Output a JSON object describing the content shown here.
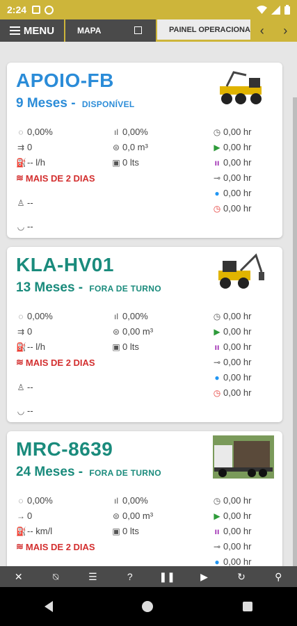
{
  "status_bar": {
    "time": "2:24"
  },
  "nav": {
    "menu_label": "MENU",
    "tabs": [
      {
        "label": "MAPA"
      },
      {
        "label": "PAINEL OPERACIONAL"
      }
    ],
    "prev_arrow": "‹",
    "next_arrow": "›"
  },
  "colors": {
    "accent": "#cdb53a",
    "dark": "#4a4a4a",
    "title_blue": "#2b8cd8",
    "title_teal": "#1a8b7c",
    "alert_red": "#d32f2f"
  },
  "cards": [
    {
      "title": "APOIO-FB",
      "months": "9 Meses",
      "status": "DISPONÍVEL",
      "title_color": "#2b8cd8",
      "status_color": "#2b8cd8",
      "image": "forwarder-machine",
      "c1": [
        "0,00%",
        "0",
        "-- l/h"
      ],
      "c2": [
        "0,00%",
        "0,0 m³",
        "0 lts"
      ],
      "c3": [
        "0,00 hr",
        "0,00 hr",
        "0,00 hr",
        "0,00 hr",
        "0,00 hr",
        "0,00 hr"
      ],
      "alert": "MAIS DE 2 DIAS",
      "operator": "--",
      "extra": "--"
    },
    {
      "title": "KLA-HV01",
      "months": "13 Meses",
      "status": "FORA DE TURNO",
      "title_color": "#1a8b7c",
      "status_color": "#1a8b7c",
      "image": "harvester-machine",
      "c1": [
        "0,00%",
        "0",
        "-- l/h"
      ],
      "c2": [
        "0,00%",
        "0,00 m³",
        "0 lts"
      ],
      "c3": [
        "0,00 hr",
        "0,00 hr",
        "0,00 hr",
        "0,00 hr",
        "0,00 hr",
        "0,00 hr"
      ],
      "alert": "MAIS DE 2 DIAS",
      "operator": "--",
      "extra": "--"
    },
    {
      "title": "MRC-8639",
      "months": "24 Meses",
      "status": "FORA DE TURNO",
      "title_color": "#1a8b7c",
      "status_color": "#1a8b7c",
      "image": "log-truck",
      "c1": [
        "0,00%",
        "0",
        "-- km/l"
      ],
      "c2": [
        "0,00%",
        "0,00 m³",
        "0 lts"
      ],
      "c3": [
        "0,00 hr",
        "0,00 hr",
        "0,00 hr",
        "0,00 hr",
        "0,00 hr"
      ],
      "alert": "MAIS DE 2 DIAS"
    }
  ],
  "toolbar_icons": [
    "mic-off-icon",
    "bell-off-icon",
    "list-icon",
    "help-icon",
    "pause-icon",
    "play-icon",
    "refresh-icon",
    "search-icon"
  ]
}
